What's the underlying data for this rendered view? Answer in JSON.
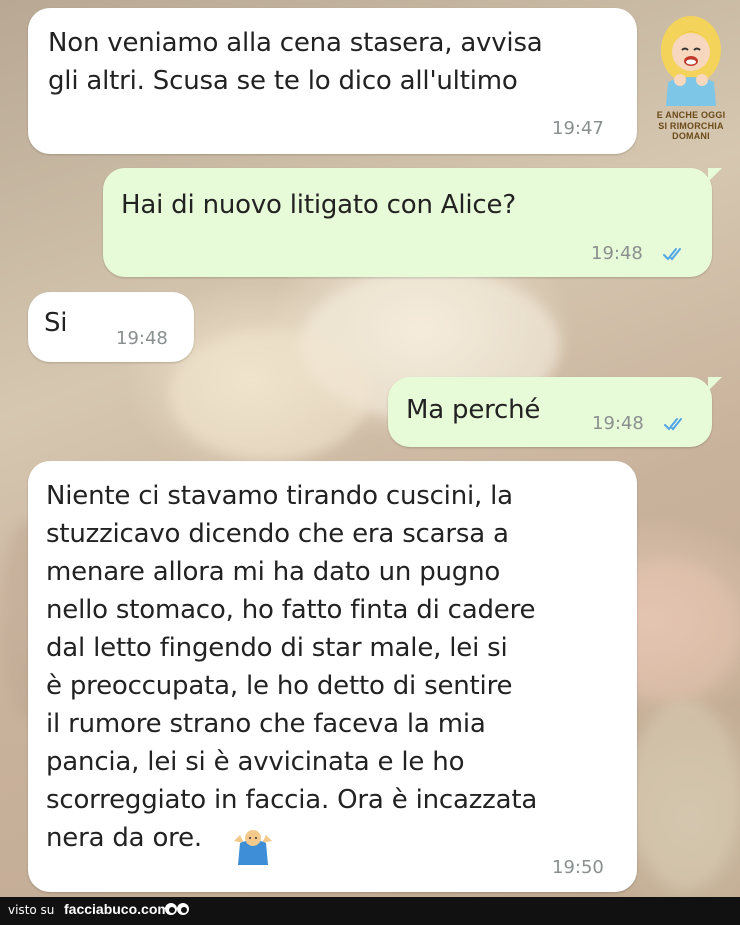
{
  "messages": [
    {
      "text": "Non veniamo alla cena stasera, avvisa\ngli altri. Scusa se te lo dico all'ultimo",
      "time": "19:47",
      "direction": "incoming"
    },
    {
      "text": "Hai di nuovo litigato con Alice?",
      "time": "19:48",
      "direction": "outgoing",
      "read": true
    },
    {
      "text": "Si",
      "time": "19:48",
      "direction": "incoming"
    },
    {
      "text": "Ma perché",
      "time": "19:48",
      "direction": "outgoing",
      "read": true
    },
    {
      "text": "Niente ci stavamo tirando cuscini, la\nstuzzicavo dicendo che era scarsa a\nmenare allora mi ha dato un pugno\nnello stomaco, ho fatto finta di cadere\ndal letto fingendo di star male, lei si\nè preoccupata, le ho detto di sentire\nil rumore strano che faceva la mia\npancia, lei si è avvicinata e le ho\nscorreggiato in faccia. Ora è incazzata\nnera da ore.",
      "time": "19:50",
      "direction": "incoming",
      "emoji": "man-shrugging-icon"
    }
  ],
  "watermark": {
    "line1": "E ANCHE OGGI",
    "line2": "SI RIMORCHIA DOMANI"
  },
  "footer": {
    "visto": "visto su",
    "site": "facciabuco.com"
  },
  "colors": {
    "incoming": "#ffffff",
    "outgoing": "#e8fbd9",
    "ticks": "#53a6e6",
    "time": "#8a8f8f"
  }
}
